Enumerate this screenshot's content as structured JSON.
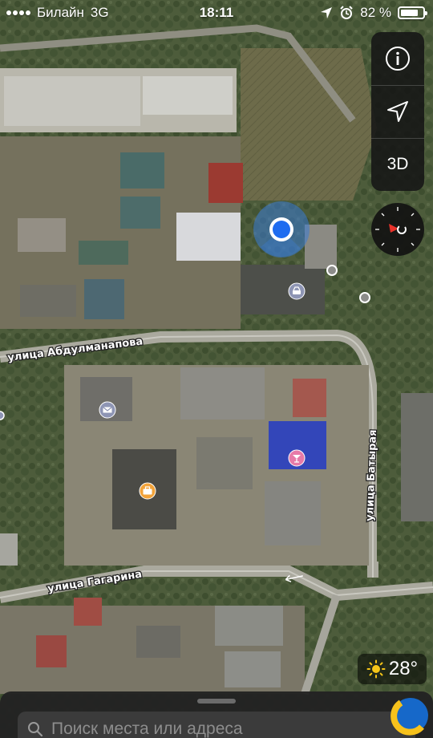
{
  "status_bar": {
    "carrier": "Билайн",
    "network": "3G",
    "time": "18:11",
    "battery": "82 %",
    "battery_level_percent": 82
  },
  "map": {
    "streets": [
      {
        "name": "улица Абдулманапова"
      },
      {
        "name": "улица Батырая"
      },
      {
        "name": "улица Гагарина"
      }
    ],
    "poi_icons": [
      "car-icon",
      "mail-icon",
      "cocktail-icon",
      "briefcase-icon"
    ]
  },
  "controls": {
    "info_icon": "info-icon",
    "location_icon": "location-arrow-icon",
    "view_3d_label": "3D",
    "compass_icon": "compass-icon"
  },
  "weather": {
    "icon": "sun-icon",
    "temperature": "28°"
  },
  "search": {
    "placeholder": "Поиск места или адреса"
  },
  "colors": {
    "user_location": "#1e6cf0",
    "user_location_halo": "#3a7bd5",
    "compass_north": "#e8322a",
    "poi_blue": "#8e95b4",
    "poi_orange": "#f2a33a",
    "poi_pink": "#e77aa8",
    "panel_bg": "#1f1f1f"
  }
}
